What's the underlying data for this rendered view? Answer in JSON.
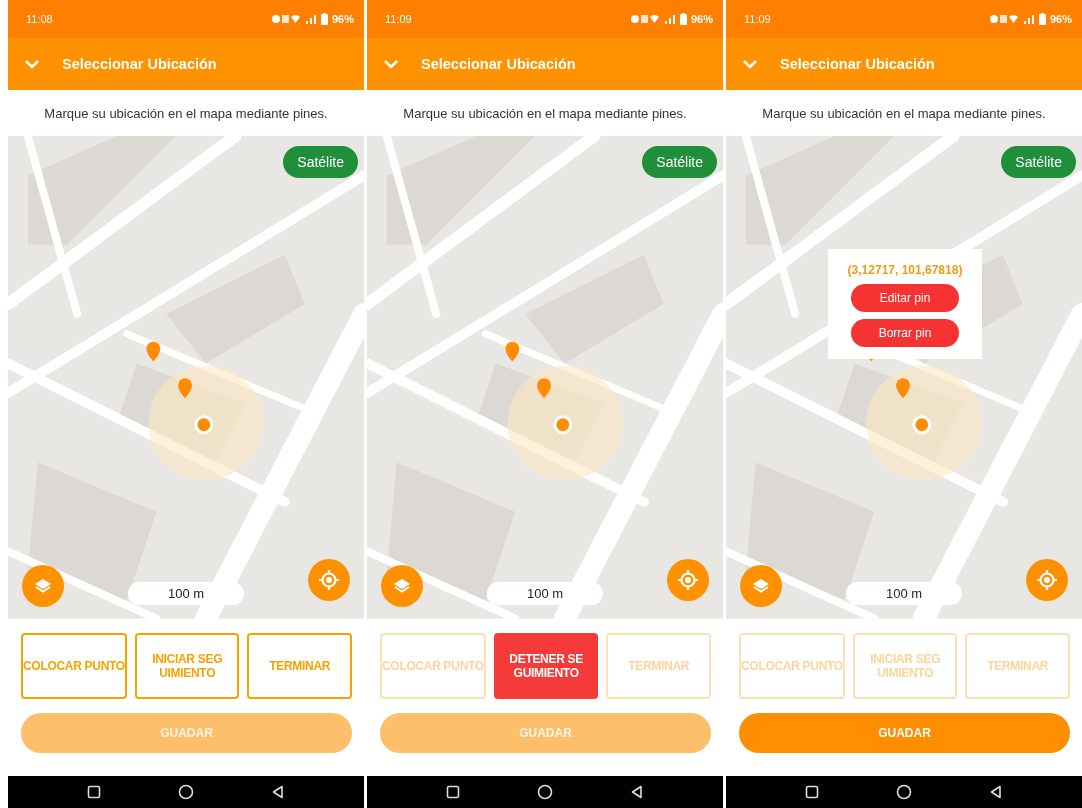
{
  "screens": [
    {
      "status_bar": {
        "time": "11:08",
        "battery": "96%"
      },
      "header": {
        "title": "Seleccionar Ubicación"
      },
      "instruction": "Marque su ubicación en el mapa mediante pines.",
      "map": {
        "map_type_button": "Satélite",
        "scale": "100 m"
      },
      "actions": [
        {
          "label": "COLOCAR PUNTO",
          "kind": "outline",
          "disabled": false
        },
        {
          "label": "INICIAR SEG\nUIMIENTO",
          "kind": "outline",
          "disabled": false
        },
        {
          "label": "TERMINAR",
          "kind": "outline",
          "disabled": false
        }
      ],
      "save_button": {
        "label": "GUADAR",
        "disabled": true
      }
    },
    {
      "status_bar": {
        "time": "11:09",
        "battery": "96%"
      },
      "header": {
        "title": "Seleccionar Ubicación"
      },
      "instruction": "Marque su ubicación en el mapa mediante pines.",
      "map": {
        "map_type_button": "Satélite",
        "scale": "100 m"
      },
      "actions": [
        {
          "label": "COLOCAR PUNTO",
          "kind": "outline",
          "disabled": true
        },
        {
          "label": "DETENER SE\nGUIMIENTO",
          "kind": "stop",
          "disabled": false
        },
        {
          "label": "TERMINAR",
          "kind": "outline",
          "disabled": true
        }
      ],
      "save_button": {
        "label": "GUADAR",
        "disabled": true
      }
    },
    {
      "status_bar": {
        "time": "11:09",
        "battery": "96%"
      },
      "header": {
        "title": "Seleccionar Ubicación"
      },
      "instruction": "Marque su ubicación en el mapa mediante pines.",
      "map": {
        "map_type_button": "Satélite",
        "scale": "100 m",
        "popup": {
          "coordinates": "(3,12717, 101,67818)",
          "buttons": [
            "Editar pin",
            "Borrar pin"
          ]
        }
      },
      "actions": [
        {
          "label": "COLOCAR PUNTO",
          "kind": "outline",
          "disabled": true
        },
        {
          "label": "INICIAR SEG\nUIMIENTO",
          "kind": "outline",
          "disabled": true
        },
        {
          "label": "TERMINAR",
          "kind": "outline",
          "disabled": true
        }
      ],
      "save_button": {
        "label": "GUADAR",
        "disabled": false
      }
    }
  ]
}
